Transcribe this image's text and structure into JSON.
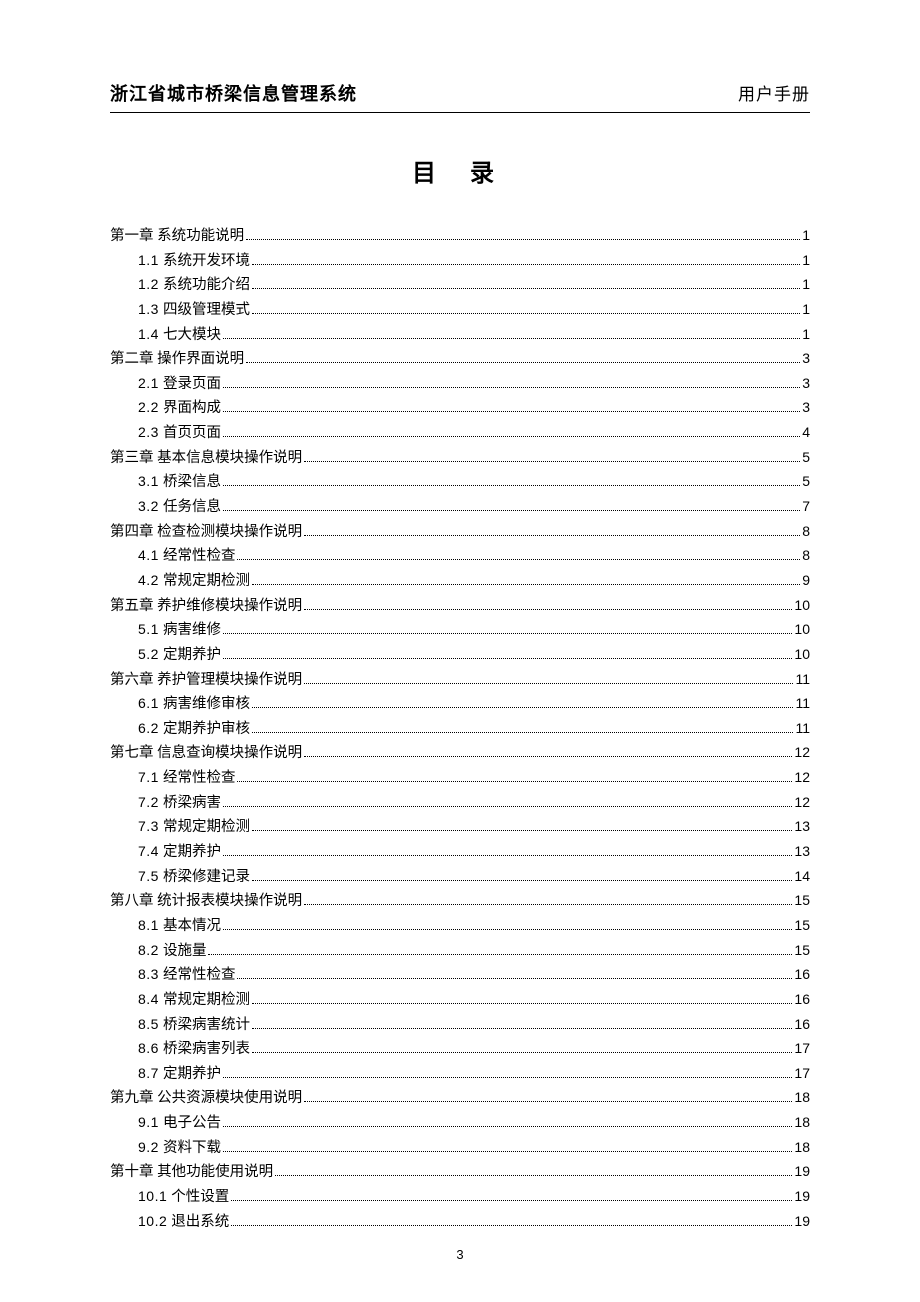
{
  "header": {
    "left": "浙江省城市桥梁信息管理系统",
    "right": "用户手册"
  },
  "title": "目 录",
  "toc": [
    {
      "level": 1,
      "num": "",
      "label": "第一章 系统功能说明",
      "page": "1"
    },
    {
      "level": 2,
      "num": "1.1",
      "label": "系统开发环境",
      "page": "1"
    },
    {
      "level": 2,
      "num": "1.2",
      "label": "系统功能介绍",
      "page": "1"
    },
    {
      "level": 2,
      "num": "1.3",
      "label": "四级管理模式",
      "page": "1"
    },
    {
      "level": 2,
      "num": "1.4",
      "label": "七大模块",
      "page": "1"
    },
    {
      "level": 1,
      "num": "",
      "label": "第二章 操作界面说明",
      "page": "3"
    },
    {
      "level": 2,
      "num": "2.1",
      "label": "登录页面",
      "page": "3"
    },
    {
      "level": 2,
      "num": "2.2",
      "label": "界面构成",
      "page": "3"
    },
    {
      "level": 2,
      "num": "2.3",
      "label": "首页页面",
      "page": "4"
    },
    {
      "level": 1,
      "num": "",
      "label": "第三章 基本信息模块操作说明",
      "page": "5"
    },
    {
      "level": 2,
      "num": "3.1",
      "label": "桥梁信息",
      "page": "5"
    },
    {
      "level": 2,
      "num": "3.2",
      "label": "任务信息",
      "page": "7"
    },
    {
      "level": 1,
      "num": "",
      "label": "第四章 检查检测模块操作说明",
      "page": "8"
    },
    {
      "level": 2,
      "num": "4.1",
      "label": "经常性检查",
      "page": "8"
    },
    {
      "level": 2,
      "num": "4.2",
      "label": "常规定期检测",
      "page": "9"
    },
    {
      "level": 1,
      "num": "",
      "label": "第五章 养护维修模块操作说明",
      "page": "10"
    },
    {
      "level": 2,
      "num": "5.1",
      "label": "病害维修",
      "page": "10"
    },
    {
      "level": 2,
      "num": "5.2",
      "label": "定期养护",
      "page": "10"
    },
    {
      "level": 1,
      "num": "",
      "label": "第六章 养护管理模块操作说明",
      "page": "11"
    },
    {
      "level": 2,
      "num": "6.1",
      "label": "病害维修审核",
      "page": "11"
    },
    {
      "level": 2,
      "num": "6.2",
      "label": "定期养护审核",
      "page": "11"
    },
    {
      "level": 1,
      "num": "",
      "label": "第七章 信息查询模块操作说明",
      "page": "12"
    },
    {
      "level": 2,
      "num": "7.1",
      "label": "经常性检查",
      "page": "12"
    },
    {
      "level": 2,
      "num": "7.2",
      "label": "桥梁病害",
      "page": "12"
    },
    {
      "level": 2,
      "num": "7.3",
      "label": "常规定期检测",
      "page": "13"
    },
    {
      "level": 2,
      "num": "7.4",
      "label": "定期养护",
      "page": "13"
    },
    {
      "level": 2,
      "num": "7.5",
      "label": "桥梁修建记录",
      "page": "14"
    },
    {
      "level": 1,
      "num": "",
      "label": "第八章 统计报表模块操作说明",
      "page": "15"
    },
    {
      "level": 2,
      "num": "8.1",
      "label": "基本情况",
      "page": "15"
    },
    {
      "level": 2,
      "num": "8.2",
      "label": "设施量",
      "page": "15"
    },
    {
      "level": 2,
      "num": "8.3",
      "label": "经常性检查",
      "page": "16"
    },
    {
      "level": 2,
      "num": "8.4",
      "label": "常规定期检测",
      "page": "16"
    },
    {
      "level": 2,
      "num": "8.5",
      "label": "桥梁病害统计",
      "page": "16"
    },
    {
      "level": 2,
      "num": "8.6",
      "label": "桥梁病害列表",
      "page": "17"
    },
    {
      "level": 2,
      "num": "8.7",
      "label": "定期养护",
      "page": "17"
    },
    {
      "level": 1,
      "num": "",
      "label": "第九章 公共资源模块使用说明",
      "page": "18"
    },
    {
      "level": 2,
      "num": "9.1",
      "label": "电子公告",
      "page": "18"
    },
    {
      "level": 2,
      "num": "9.2",
      "label": "资料下载",
      "page": "18"
    },
    {
      "level": 1,
      "num": "",
      "label": "第十章 其他功能使用说明",
      "page": "19"
    },
    {
      "level": 2,
      "num": "10.1",
      "label": "个性设置",
      "page": "19"
    },
    {
      "level": 2,
      "num": "10.2",
      "label": "退出系统",
      "page": "19"
    }
  ],
  "footer": {
    "page_number": "3"
  }
}
